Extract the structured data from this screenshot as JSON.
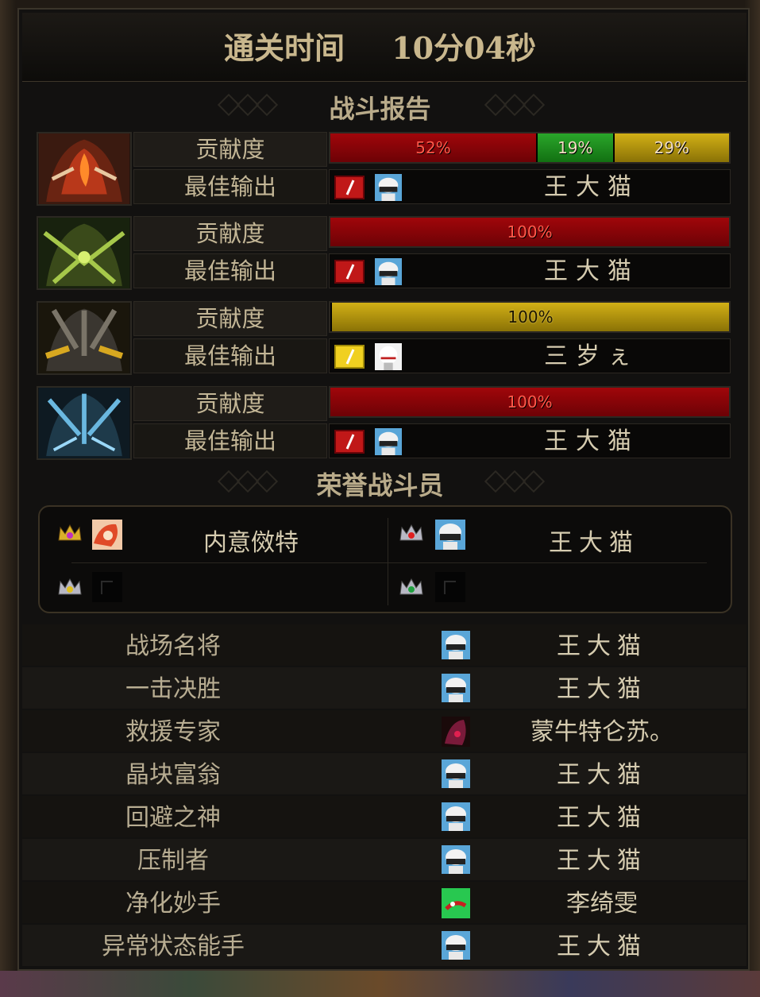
{
  "header": {
    "label": "通关时间",
    "time": "10分04秒"
  },
  "sections": {
    "report": "战斗报告",
    "honor": "荣誉战斗员"
  },
  "row_labels": {
    "contribution": "贡献度",
    "best_output": "最佳输出"
  },
  "bosses": [
    {
      "portrait": "fire-boss-icon",
      "segments": [
        {
          "label": "52%",
          "value": 52,
          "color": "red"
        },
        {
          "label": "19%",
          "value": 19,
          "color": "green"
        },
        {
          "label": "29%",
          "value": 29,
          "color": "gold"
        }
      ],
      "best_job": "red",
      "best_name": "王大猫"
    },
    {
      "portrait": "nature-boss-icon",
      "segments": [
        {
          "label": "100%",
          "value": 100,
          "color": "red"
        }
      ],
      "best_job": "red",
      "best_name": "王大猫"
    },
    {
      "portrait": "gold-boss-icon",
      "segments": [
        {
          "label": "100%",
          "value": 100,
          "color": "gold"
        }
      ],
      "best_job": "gold",
      "best_name": "三岁ぇ"
    },
    {
      "portrait": "ice-boss-icon",
      "segments": [
        {
          "label": "100%",
          "value": 100,
          "color": "red"
        }
      ],
      "best_job": "red",
      "best_name": "王大猫"
    }
  ],
  "honor": {
    "top_left": "内意傚特",
    "top_right": "王大猫"
  },
  "awards": [
    {
      "title": "战场名将",
      "player": "王大猫",
      "avatar": "white-hair-avatar"
    },
    {
      "title": "一击决胜",
      "player": "王大猫",
      "avatar": "white-hair-avatar"
    },
    {
      "title": "救援专家",
      "player": "蒙牛特仑苏。",
      "avatar": "dark-red-avatar"
    },
    {
      "title": "晶块富翁",
      "player": "王大猫",
      "avatar": "white-hair-avatar"
    },
    {
      "title": "回避之神",
      "player": "王大猫",
      "avatar": "white-hair-avatar"
    },
    {
      "title": "压制者",
      "player": "王大猫",
      "avatar": "white-hair-avatar"
    },
    {
      "title": "净化妙手",
      "player": "李绮雯",
      "avatar": "green-avatar"
    },
    {
      "title": "异常状态能手",
      "player": "王大猫",
      "avatar": "white-hair-avatar"
    }
  ],
  "colors": {
    "red": "#a0060a",
    "green": "#2aa62a",
    "gold": "#d2b016",
    "text": "#d6ccb0"
  }
}
